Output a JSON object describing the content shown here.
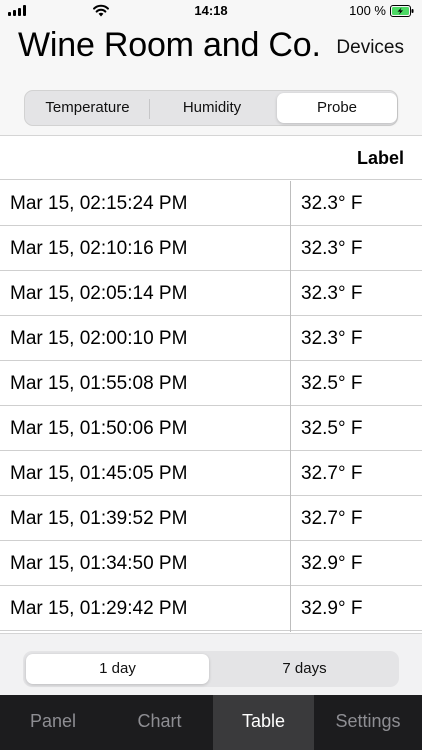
{
  "status_bar": {
    "time": "14:18",
    "battery_percent": "100 %",
    "icons": [
      "signal-icon",
      "wifi-icon",
      "battery-charging-icon"
    ]
  },
  "header": {
    "title": "Wine Room and Co...",
    "devices_label": "Devices"
  },
  "sensor_tabs": {
    "items": [
      "Temperature",
      "Humidity",
      "Probe"
    ],
    "selected": "Probe"
  },
  "table": {
    "label_header": "Label",
    "rows": [
      {
        "date": "Mar 15, 02:15:24 PM",
        "value": "32.3° F"
      },
      {
        "date": "Mar 15, 02:10:16 PM",
        "value": "32.3° F"
      },
      {
        "date": "Mar 15, 02:05:14 PM",
        "value": "32.3° F"
      },
      {
        "date": "Mar 15, 02:00:10 PM",
        "value": "32.3° F"
      },
      {
        "date": "Mar 15, 01:55:08 PM",
        "value": "32.5° F"
      },
      {
        "date": "Mar 15, 01:50:06 PM",
        "value": "32.5° F"
      },
      {
        "date": "Mar 15, 01:45:05 PM",
        "value": "32.7° F"
      },
      {
        "date": "Mar 15, 01:39:52 PM",
        "value": "32.7° F"
      },
      {
        "date": "Mar 15, 01:34:50 PM",
        "value": "32.9° F"
      },
      {
        "date": "Mar 15, 01:29:42 PM",
        "value": "32.9° F"
      }
    ]
  },
  "range_tabs": {
    "items": [
      "1 day",
      "7 days"
    ],
    "selected": "1 day"
  },
  "tab_bar": {
    "items": [
      "Panel",
      "Chart",
      "Table",
      "Settings"
    ],
    "selected": "Table"
  },
  "colors": {
    "battery_green": "#4cd964",
    "tabbar_bg": "#1c1c1e",
    "tabbar_active_bg": "#3a3a3c"
  }
}
